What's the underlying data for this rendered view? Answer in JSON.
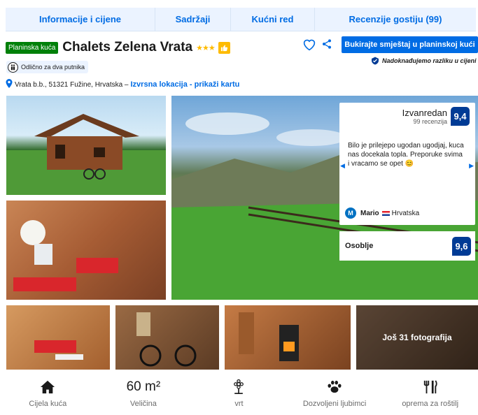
{
  "tabs": [
    "Informacije i cijene",
    "Sadržaji",
    "Kućni red",
    "Recenzije gostiju (99)"
  ],
  "property": {
    "type_badge": "Planinska kuća",
    "name": "Chalets Zelena Vrata",
    "stars": "★★★",
    "book_button": "Bukirajte smještaj u planinskoj kući",
    "price_match": "Nadoknađujemo razliku u cijeni",
    "couple_badge": "Odlično za dva putnika",
    "address": "Vrata b.b., 51321 Fužine, Hrvatska –",
    "location_link": "Izvrsna lokacija - prikaži kartu"
  },
  "review": {
    "rating_word": "Izvanredan",
    "review_count": "99 recenzija",
    "score": "9,4",
    "quote": "Bilo je prilejepo ugodan ugodjaj, kuca nas docekala topla. Preporuke svima i vracamo se opet",
    "reviewer_initial": "M",
    "reviewer_name": "Mario",
    "reviewer_country": "Hrvatska",
    "staff_label": "Osoblje",
    "staff_score": "9,6"
  },
  "gallery": {
    "more_photos": "Još 31 fotografija"
  },
  "amenities": [
    {
      "icon": "house-icon",
      "label": "Cijela kuća"
    },
    {
      "icon": "size-text",
      "value": "60 m²",
      "label": "Veličina"
    },
    {
      "icon": "flower-icon",
      "label": "vrt"
    },
    {
      "icon": "paw-icon",
      "label": "Dozvoljeni ljubimci"
    },
    {
      "icon": "grill-utensils-icon",
      "label": "oprema za roštilj"
    }
  ],
  "colors": {
    "brand_blue": "#006ce4",
    "score_blue": "#003b95",
    "badge_green": "#008009",
    "star_yellow": "#febb02"
  }
}
